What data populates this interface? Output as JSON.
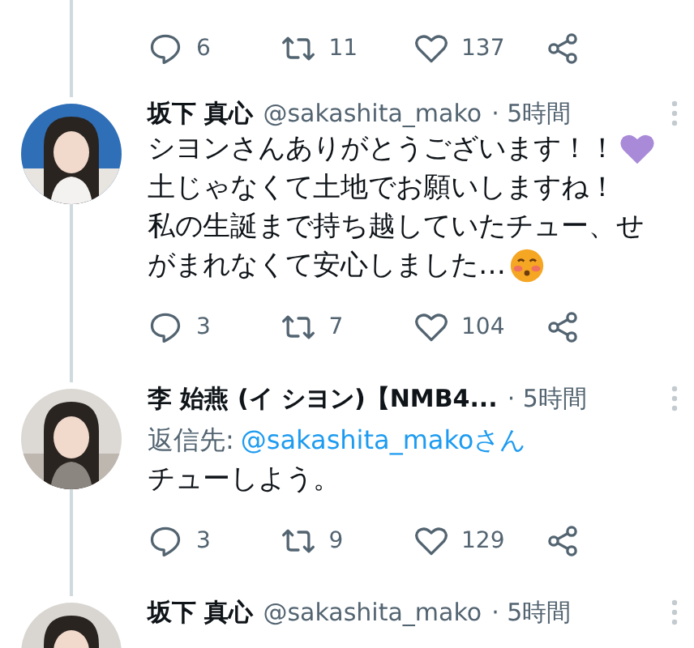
{
  "thread": [
    {
      "actions": {
        "replies": "6",
        "retweets": "11",
        "likes": "137"
      }
    },
    {
      "name": "坂下 真心",
      "handle": "@sakashita_mako",
      "time": "· 5時間",
      "body": [
        [
          {
            "kind": "text",
            "text": "シヨンさんありがとうございます！！"
          },
          {
            "kind": "heart_emoji"
          }
        ],
        [
          {
            "kind": "text",
            "text": "土じゃなくて土地でお願いしますね！"
          }
        ],
        [
          {
            "kind": "text",
            "text": "私の生誕まで持ち越していたチュー、せ"
          }
        ],
        [
          {
            "kind": "text",
            "text": "がまれなくて安心しました…"
          },
          {
            "kind": "blush_emoji"
          }
        ]
      ],
      "actions": {
        "replies": "3",
        "retweets": "7",
        "likes": "104"
      }
    },
    {
      "name": "李 始燕 (イ シヨン)【NMB4...",
      "time": "· 5時間",
      "reply_to": {
        "label": "返信先:",
        "handle": "@sakashita_makoさん"
      },
      "body": [
        [
          {
            "kind": "text",
            "text": "チューしよう。"
          }
        ]
      ],
      "actions": {
        "replies": "3",
        "retweets": "9",
        "likes": "129"
      }
    },
    {
      "name": "坂下 真心",
      "handle": "@sakashita_mako",
      "time": "· 5時間"
    }
  ]
}
